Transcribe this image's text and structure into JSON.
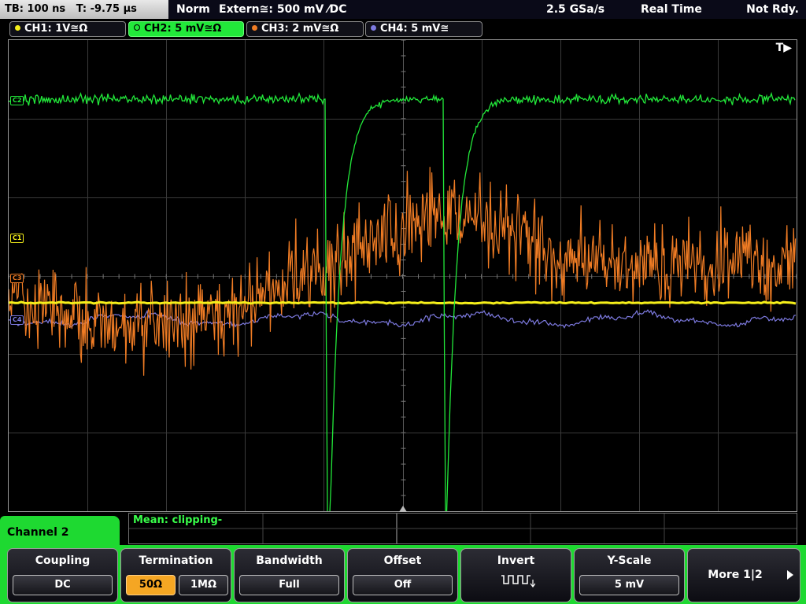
{
  "status": {
    "timebase": "TB: 100 ns",
    "trigger_time": "T: -9.75 µs",
    "mode": "Norm",
    "trigger_source": "Extern≅: 500 mV ⁄DC",
    "sample_rate": "2.5 GSa/s",
    "acquisition": "Real Time",
    "state": "Not Rdy."
  },
  "channels": [
    {
      "label": "CH1: 1V≅Ω",
      "color": "#f5ef1a",
      "marker": "C1"
    },
    {
      "label": "CH2: 5 mV≅Ω",
      "color": "#22e83a",
      "marker": "C2"
    },
    {
      "label": "CH3: 2 mV≅Ω",
      "color": "#f07c24",
      "marker": "C3"
    },
    {
      "label": "CH4: 5 mV≅",
      "color": "#7d7ae0",
      "marker": "C4"
    }
  ],
  "trigger_marker": "T▶",
  "measurement": "Mean: clipping-",
  "menu": {
    "title": "Channel 2",
    "softkeys": [
      {
        "title": "Coupling",
        "value": "DC"
      },
      {
        "title": "Termination",
        "values": [
          "50Ω",
          "1MΩ"
        ],
        "selected": 0
      },
      {
        "title": "Bandwidth",
        "value": "Full"
      },
      {
        "title": "Offset",
        "value": "Off"
      },
      {
        "title": "Invert",
        "icon": "inverted-square-wave-icon"
      },
      {
        "title": "Y-Scale",
        "value": "5 mV"
      },
      {
        "title": "More 1|2",
        "icon": "right-triangle-icon"
      }
    ]
  }
}
